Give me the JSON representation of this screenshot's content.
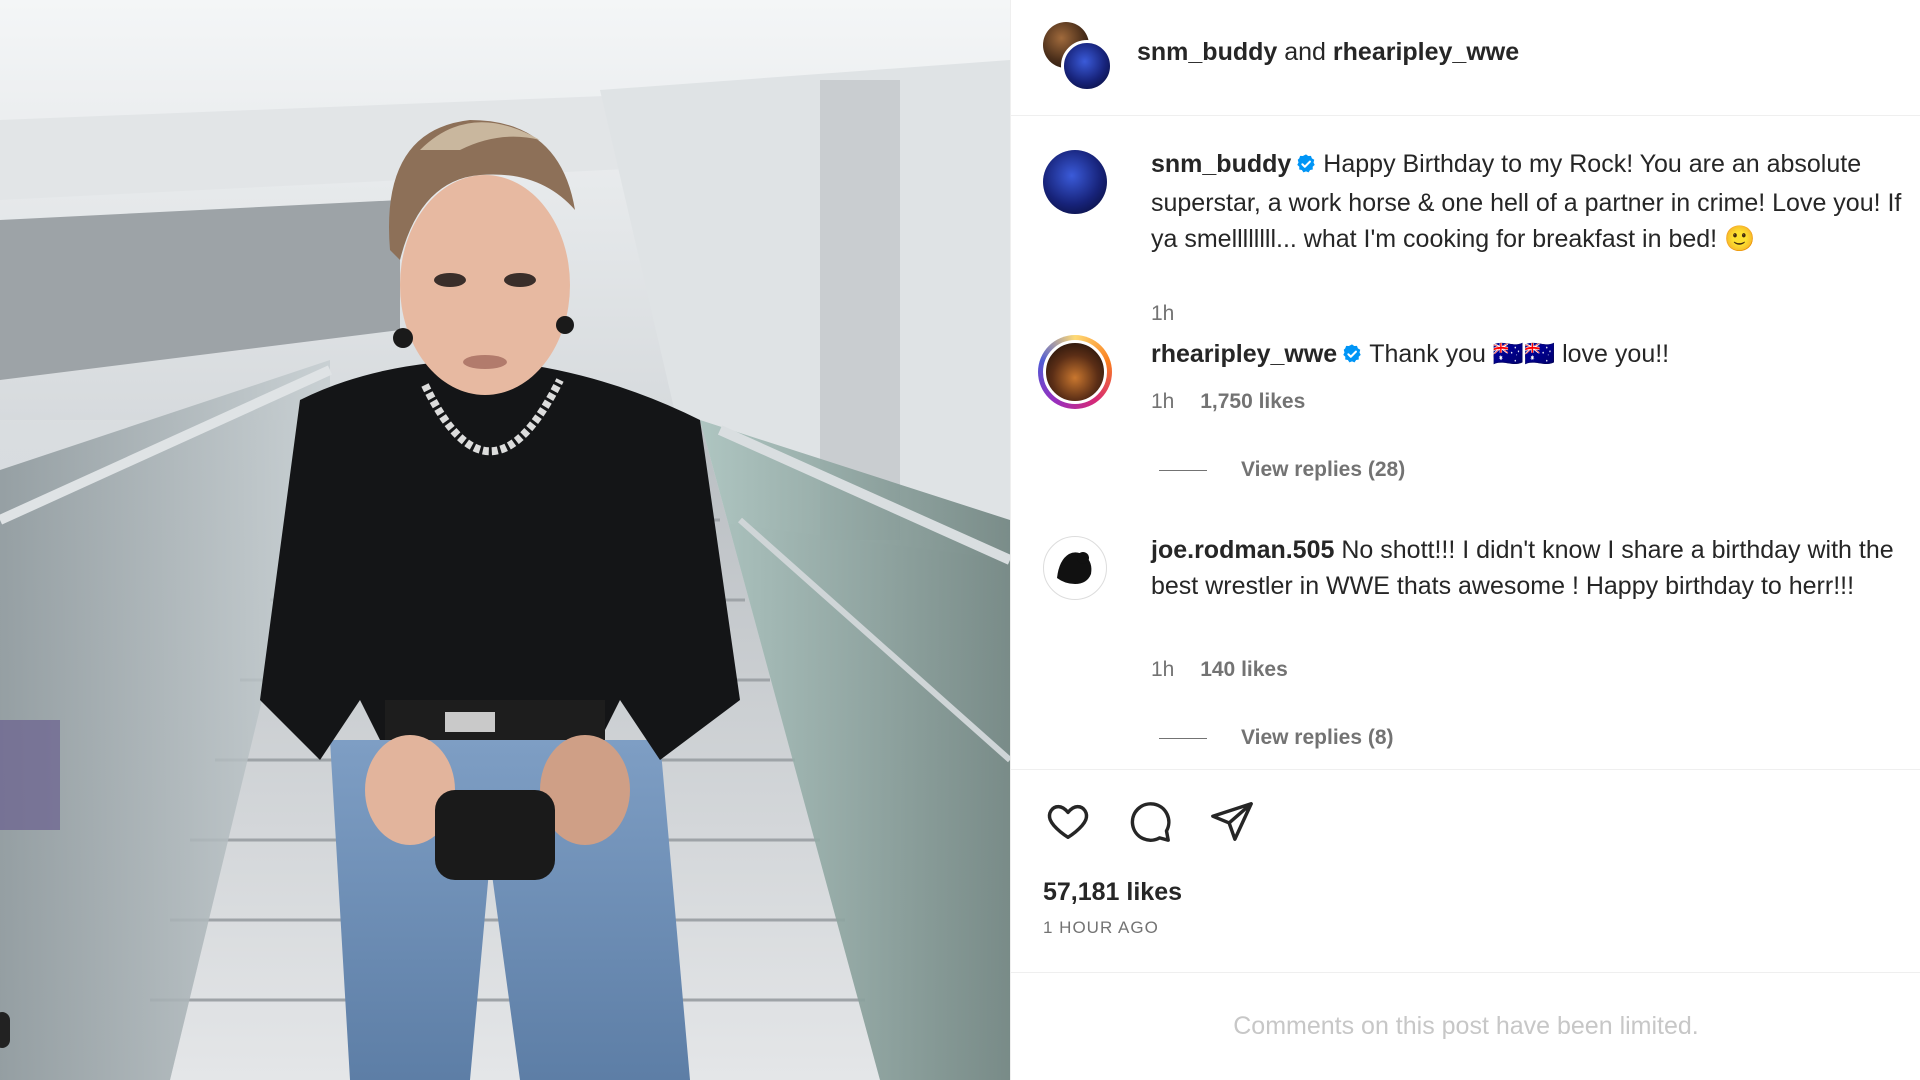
{
  "header": {
    "user1": "snm_buddy",
    "conjunction": "and",
    "user2": "rhearipley_wwe"
  },
  "comments": [
    {
      "username": "snm_buddy",
      "verified": true,
      "text": "Happy Birthday to my Rock! You are an absolute superstar, a work horse & one hell of a partner in crime! Love you! If ya smellllllll... what I'm cooking for breakfast in bed! 🙂",
      "time": "1h"
    },
    {
      "username": "rhearipley_wwe",
      "verified": true,
      "text": "Thank you 🇦🇺🇦🇺 love you!!",
      "time": "1h",
      "likes": "1,750 likes",
      "view_replies": "View replies (28)"
    },
    {
      "username": "joe.rodman.505",
      "verified": false,
      "text": "No shott!!! I didn't know I share a birthday with the best wrestler in WWE thats awesome ! Happy birthday to herr!!!",
      "time": "1h",
      "likes": "140 likes",
      "view_replies": "View replies (8)"
    }
  ],
  "actions": {
    "like_icon": "heart-icon",
    "comment_icon": "comment-bubble-icon",
    "share_icon": "paper-plane-icon"
  },
  "post": {
    "likes": "57,181 likes",
    "time_ago": "1 HOUR AGO"
  },
  "footer": {
    "comments_limited": "Comments on this post have been limited."
  },
  "colors": {
    "verified_blue": "#0095f6",
    "secondary_text": "#737373",
    "primary_text": "#262626"
  }
}
